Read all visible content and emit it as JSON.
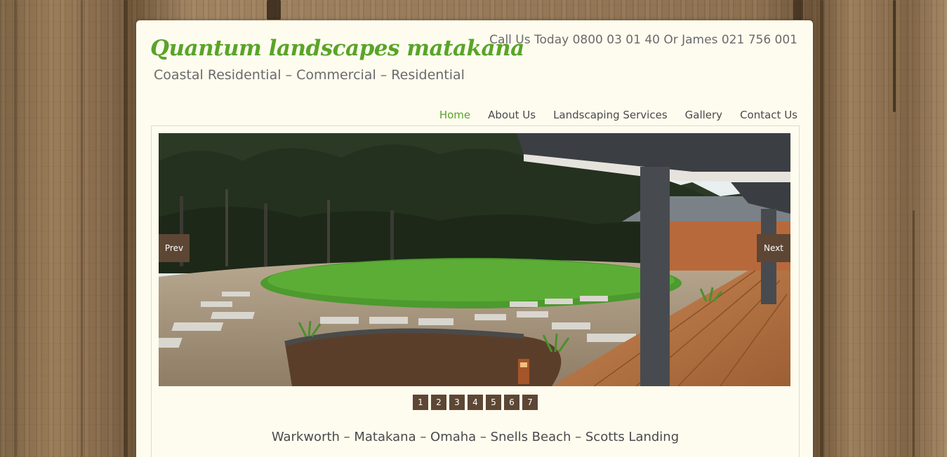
{
  "header": {
    "logo_text": "Quantum landscapes matakana",
    "tagline": "Coastal Residential – Commercial – Residential",
    "phone": "Call Us Today 0800 03 01 40 Or James 021 756 001"
  },
  "nav": {
    "items": [
      {
        "label": "Home",
        "active": true
      },
      {
        "label": "About Us",
        "active": false
      },
      {
        "label": "Landscaping Services",
        "active": false
      },
      {
        "label": "Gallery",
        "active": false
      },
      {
        "label": "Contact Us",
        "active": false
      }
    ]
  },
  "slider": {
    "prev_label": "Prev",
    "next_label": "Next",
    "pages": [
      "1",
      "2",
      "3",
      "4",
      "5",
      "6",
      "7"
    ]
  },
  "content": {
    "locations": "Warkworth – Matakana – Omaha – Snells Beach – Scotts Landing"
  },
  "colors": {
    "brand_green": "#5aa428",
    "page_bg": "#fefcef",
    "button_brown": "#5d4634",
    "text_grey": "#6a6a6a"
  }
}
